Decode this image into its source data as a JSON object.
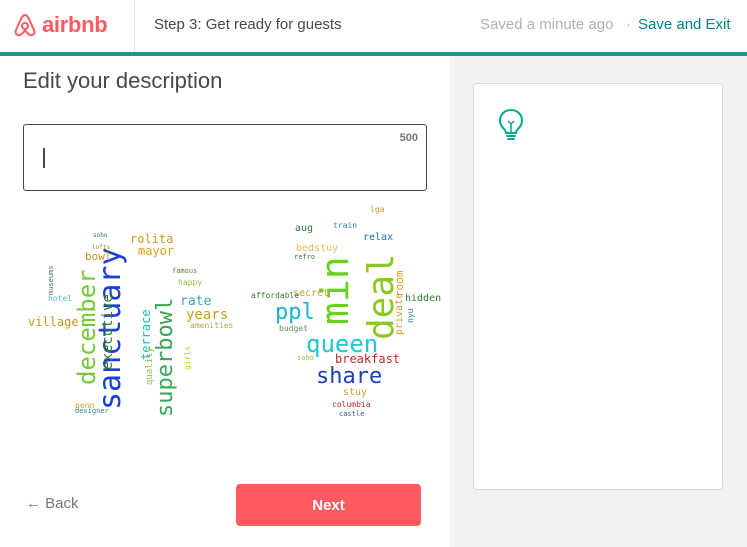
{
  "header": {
    "brand": "airbnb",
    "step": "Step 3: Get ready for guests",
    "saved_status": "Saved a minute ago",
    "separator": "·",
    "save_exit": "Save and Exit",
    "accent": "#159a8c"
  },
  "main": {
    "title": "Edit your description",
    "description_value": "",
    "char_counter": "500"
  },
  "word_clouds": [
    {
      "words": [
        {
          "text": "sanctuary",
          "color": "#1a3fd6",
          "size": 30,
          "rot": -90
        },
        {
          "text": "december",
          "color": "#76c936",
          "size": 24,
          "rot": -90
        },
        {
          "text": "superbowl",
          "color": "#34a853",
          "size": 22,
          "rot": -90
        },
        {
          "text": "executive",
          "color": "#2e7d32",
          "size": 14,
          "rot": -90
        },
        {
          "text": "terrace",
          "color": "#19b7c4",
          "size": 12,
          "rot": -90
        },
        {
          "text": "quality",
          "color": "#8bc34a",
          "size": 9,
          "rot": -90
        },
        {
          "text": "girls",
          "color": "#c0ca33",
          "size": 8,
          "rot": -90
        },
        {
          "text": "rolita",
          "color": "#c39b1a",
          "size": 12,
          "rot": 0
        },
        {
          "text": "mayor",
          "color": "#e39d1e",
          "size": 12,
          "rot": 0
        },
        {
          "text": "bowl",
          "color": "#d19019",
          "size": 11,
          "rot": 0
        },
        {
          "text": "rate",
          "color": "#3ba5c2",
          "size": 13,
          "rot": 0
        },
        {
          "text": "years",
          "color": "#c7a01c",
          "size": 14,
          "rot": 0
        },
        {
          "text": "village",
          "color": "#d29018",
          "size": 12,
          "rot": 0
        },
        {
          "text": "hotel",
          "color": "#56b7c4",
          "size": 8,
          "rot": 0
        },
        {
          "text": "happy",
          "color": "#8bc34a",
          "size": 8,
          "rot": 0
        },
        {
          "text": "amenities",
          "color": "#b5a642",
          "size": 8,
          "rot": 0
        },
        {
          "text": "famous",
          "color": "#5f7d34",
          "size": 7,
          "rot": 0
        },
        {
          "text": "museums",
          "color": "#4a7c59",
          "size": 7,
          "rot": -90
        },
        {
          "text": "designer",
          "color": "#2a8a94",
          "size": 7,
          "rot": 0
        },
        {
          "text": "penn",
          "color": "#c9a227",
          "size": 8,
          "rot": 0
        },
        {
          "text": "soho",
          "color": "#2d6a78",
          "size": 6,
          "rot": 0
        },
        {
          "text": "lofts",
          "color": "#7b9e3a",
          "size": 6,
          "rot": 0
        }
      ]
    },
    {
      "words": [
        {
          "text": "min",
          "color": "#6ad11a",
          "size": 38,
          "rot": -90
        },
        {
          "text": "deal",
          "color": "#8bc820",
          "size": 36,
          "rot": -90
        },
        {
          "text": "queen",
          "color": "#22c7d3",
          "size": 24,
          "rot": 0
        },
        {
          "text": "share",
          "color": "#1a3fb8",
          "size": 22,
          "rot": 0
        },
        {
          "text": "ppl",
          "color": "#19b2cf",
          "size": 22,
          "rot": 0
        },
        {
          "text": "breakfast",
          "color": "#c62828",
          "size": 12,
          "rot": 0
        },
        {
          "text": "room",
          "color": "#e39d1e",
          "size": 11,
          "rot": -90
        },
        {
          "text": "private",
          "color": "#c9a227",
          "size": 10,
          "rot": -90
        },
        {
          "text": "hidden",
          "color": "#2e7d32",
          "size": 10,
          "rot": 0
        },
        {
          "text": "secret",
          "color": "#c9a227",
          "size": 10,
          "rot": 0
        },
        {
          "text": "bedstuy",
          "color": "#e0c05a",
          "size": 10,
          "rot": 0
        },
        {
          "text": "relax",
          "color": "#1a73a8",
          "size": 10,
          "rot": 0
        },
        {
          "text": "aug",
          "color": "#2e7d32",
          "size": 10,
          "rot": 0
        },
        {
          "text": "stuy",
          "color": "#c9a227",
          "size": 10,
          "rot": 0
        },
        {
          "text": "affordable",
          "color": "#2e7d32",
          "size": 8,
          "rot": 0
        },
        {
          "text": "budget",
          "color": "#5f8d6a",
          "size": 8,
          "rot": 0
        },
        {
          "text": "columbia",
          "color": "#c62828",
          "size": 8,
          "rot": 0
        },
        {
          "text": "castle",
          "color": "#2a5ca8",
          "size": 7,
          "rot": 0
        },
        {
          "text": "lga",
          "color": "#d19019",
          "size": 8,
          "rot": 0
        },
        {
          "text": "train",
          "color": "#2a8a94",
          "size": 8,
          "rot": 0
        },
        {
          "text": "refro",
          "color": "#2e7d32",
          "size": 7,
          "rot": 0
        },
        {
          "text": "soho",
          "color": "#8bc34a",
          "size": 7,
          "rot": 0
        },
        {
          "text": "nyu",
          "color": "#1a73a8",
          "size": 8,
          "rot": -90
        }
      ]
    }
  ],
  "sidebar": {
    "icon": "lightbulb-icon",
    "icon_color": "#00a699"
  },
  "footer": {
    "back_label": "← Back",
    "next_label": "Next",
    "next_color": "#ff5a5f"
  }
}
